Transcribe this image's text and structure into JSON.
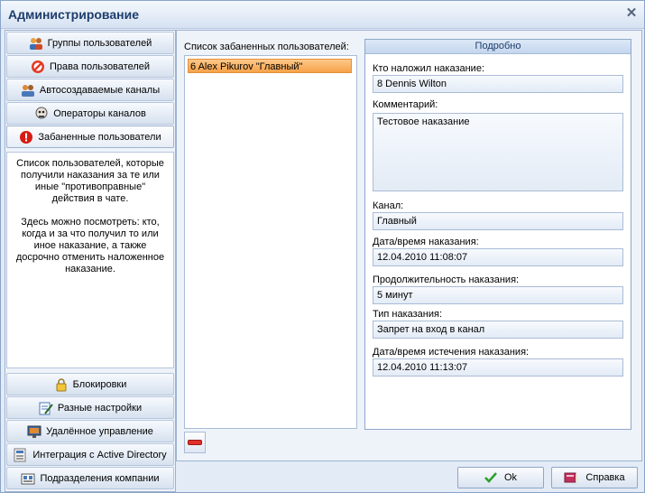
{
  "window": {
    "title": "Администрирование"
  },
  "nav": {
    "top_items": [
      {
        "label": "Группы пользователей",
        "icon": "users-group-icon"
      },
      {
        "label": "Права пользователей",
        "icon": "no-entry-icon"
      },
      {
        "label": "Автосоздаваемые каналы",
        "icon": "channel-people-icon"
      },
      {
        "label": "Операторы каналов",
        "icon": "operator-icon"
      },
      {
        "label": "Забаненные пользователи",
        "icon": "warning-icon"
      }
    ],
    "description": {
      "p1": "Список пользователей, которые получили наказания за те или иные \"противоправные\" действия в чате.",
      "p2": "Здесь можно посмотреть: кто, когда и за что получил то или иное наказание, а также досрочно отменить наложенное наказание."
    },
    "bottom_items": [
      {
        "label": "Блокировки",
        "icon": "lock-icon"
      },
      {
        "label": "Разные настройки",
        "icon": "settings-edit-icon"
      },
      {
        "label": "Удалённое управление",
        "icon": "remote-monitor-icon"
      },
      {
        "label": "Интеграция с Active Directory",
        "icon": "directory-icon"
      },
      {
        "label": "Подразделения компании",
        "icon": "company-icon"
      }
    ]
  },
  "banned": {
    "list_label": "Список забаненных пользователей:",
    "items": [
      "6 Alex Pikurov \"Главный\""
    ]
  },
  "details": {
    "header": "Подробно",
    "imposed_by_label": "Кто наложил наказание:",
    "imposed_by": "8 Dennis Wilton",
    "comment_label": "Комментарий:",
    "comment": "Тестовое наказание",
    "channel_label": "Канал:",
    "channel": "Главный",
    "datetime_label": "Дата/время наказания:",
    "datetime": "12.04.2010 11:08:07",
    "duration_label": "Продолжительность наказания:",
    "duration": "5 минут",
    "type_label": "Тип наказания:",
    "type": "Запрет на вход в канал",
    "expires_label": "Дата/время истечения наказания:",
    "expires": "12.04.2010 11:13:07"
  },
  "buttons": {
    "ok": "Ok",
    "help": "Справка"
  },
  "colors": {
    "accent": "#f6a24a",
    "title": "#1e3d6b"
  }
}
